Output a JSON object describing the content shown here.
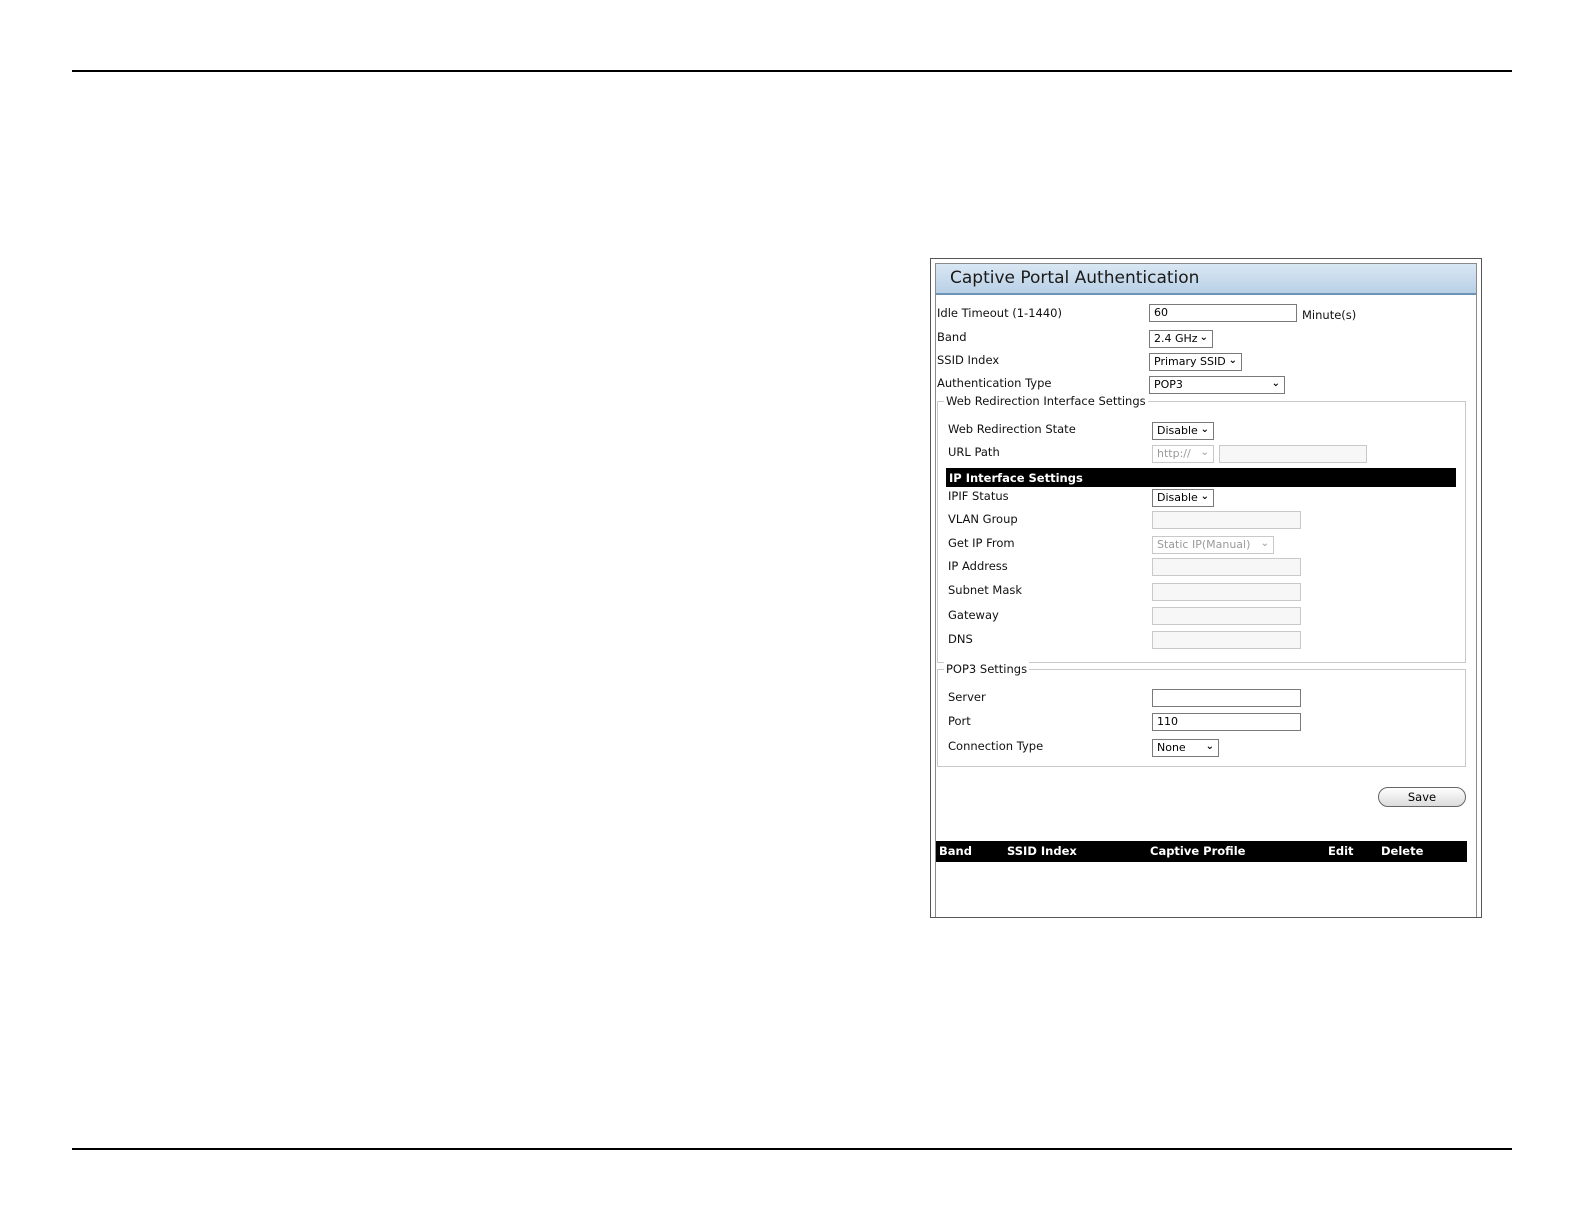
{
  "title": "Captive Portal Authentication",
  "general": {
    "idle_timeout_label": "Idle Timeout (1-1440)",
    "idle_timeout_value": "60",
    "idle_timeout_unit": "Minute(s)",
    "band_label": "Band",
    "band_value": "2.4 GHz",
    "ssid_index_label": "SSID Index",
    "ssid_index_value": "Primary SSID",
    "auth_type_label": "Authentication Type",
    "auth_type_value": "POP3"
  },
  "web_redirection": {
    "legend": "Web Redirection Interface Settings",
    "state_label": "Web Redirection State",
    "state_value": "Disable",
    "url_path_label": "URL Path",
    "url_scheme_value": "http://",
    "url_path_value": ""
  },
  "ip_interface": {
    "header": "IP Interface Settings",
    "ipif_status_label": "IPIF Status",
    "ipif_status_value": "Disable",
    "vlan_group_label": "VLAN Group",
    "vlan_group_value": "",
    "get_ip_from_label": "Get IP From",
    "get_ip_from_value": "Static IP(Manual)",
    "ip_address_label": "IP Address",
    "ip_address_value": "",
    "subnet_mask_label": "Subnet Mask",
    "subnet_mask_value": "",
    "gateway_label": "Gateway",
    "gateway_value": "",
    "dns_label": "DNS",
    "dns_value": ""
  },
  "pop3": {
    "legend": "POP3 Settings",
    "server_label": "Server",
    "server_value": "",
    "port_label": "Port",
    "port_value": "110",
    "connection_type_label": "Connection Type",
    "connection_type_value": "None"
  },
  "save_label": "Save",
  "table": {
    "columns": [
      "Band",
      "SSID Index",
      "Captive Profile",
      "Edit",
      "Delete"
    ]
  },
  "icons": {
    "dropdown": "chevron-down-icon"
  }
}
